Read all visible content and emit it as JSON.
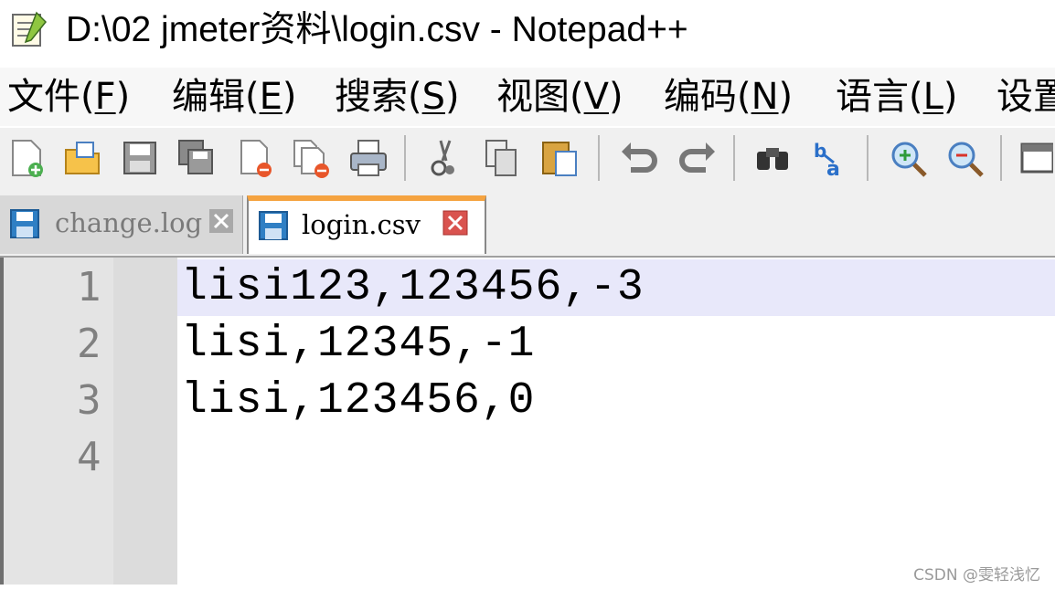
{
  "window": {
    "title": "D:\\02 jmeter资料\\login.csv - Notepad++",
    "icon": "notepad-icon"
  },
  "menu": {
    "items": [
      {
        "label": "文件(",
        "key": "F",
        "close": ")"
      },
      {
        "label": "编辑(",
        "key": "E",
        "close": ")"
      },
      {
        "label": "搜索(",
        "key": "S",
        "close": ")"
      },
      {
        "label": "视图(",
        "key": "V",
        "close": ")"
      },
      {
        "label": "编码(",
        "key": "N",
        "close": ")"
      },
      {
        "label": "语言(",
        "key": "L",
        "close": ")"
      },
      {
        "label": "设置",
        "key": "",
        "close": ""
      }
    ]
  },
  "toolbar": {
    "icons": [
      "new-file-icon",
      "open-file-icon",
      "save-icon",
      "save-all-icon",
      "close-icon",
      "close-all-icon",
      "print-icon",
      "cut-icon",
      "copy-icon",
      "paste-icon",
      "undo-icon",
      "redo-icon",
      "find-icon",
      "replace-icon",
      "zoom-in-icon",
      "zoom-out-icon",
      "sync-view-icon"
    ]
  },
  "tabs": [
    {
      "label": "change.log",
      "active": false
    },
    {
      "label": "login.csv",
      "active": true
    }
  ],
  "editor": {
    "lines": [
      {
        "number": "1",
        "text": "lisi123,123456,-3"
      },
      {
        "number": "2",
        "text": "lisi,12345,-1"
      },
      {
        "number": "3",
        "text": "lisi,123456,0"
      },
      {
        "number": "4",
        "text": ""
      }
    ]
  },
  "watermark": "CSDN @雯轻浅忆",
  "colors": {
    "active_tab_accent": "#f5a340",
    "current_line": "#e8e8fa",
    "close_button": "#d9534f",
    "save_icon": "#2f7fc4"
  }
}
